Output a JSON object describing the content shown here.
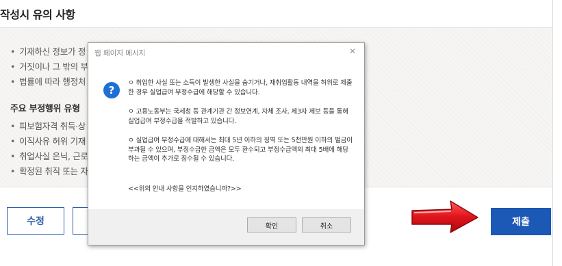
{
  "page": {
    "section_title": "작성시 유의 사항",
    "bullets_top": [
      "기재하신 정보가 정",
      "거짓이나 그 밖의 부",
      "법률에 따라 행정처"
    ],
    "subhead": "주요 부정행위 유형",
    "bullets_bottom": [
      "피보험자격 취득·상",
      "이직사유 허위 기재",
      "취업사실 은닉, 근로",
      "확정된 취직 또는 자"
    ],
    "edit_button": "수정",
    "submit_button": "제출"
  },
  "dialog": {
    "title": "웹 페이지 메시지",
    "close_symbol": "✕",
    "icon_symbol": "?",
    "paragraphs": [
      "ㅇ 취업한 사실 또는 소득이 발생한 사실을 숨기거나, 재취업활동 내역을 허위로 제출한 경우 실업급여 부정수급에 해당할 수 있습니다.",
      "ㅇ 고용노동부는 국세청 등 관계기관 간 정보연계, 자체 조사, 제3자 제보 등을 통해 실업급여 부정수급을 적발하고 있습니다.",
      "ㅇ 실업급여 부정수급에 대해서는 최대 5년 이하의 징역 또는 5천만원 이하의 벌금이 부과될 수 있으며, 부정수급한 금액은 모두 환수되고 부정수급액의 최대 5배에 해당하는 금액이 추가로 징수될 수 있습니다.",
      "<<위의 안내 사항을 인지하였습니까?>>"
    ],
    "ok_button": "확인",
    "cancel_button": "취소"
  },
  "colors": {
    "accent_blue": "#1c58b5",
    "arrow_red": "#e0141b"
  },
  "icons": {
    "question": "question-icon",
    "close": "close-icon",
    "arrow": "red-arrow-right-icon"
  }
}
